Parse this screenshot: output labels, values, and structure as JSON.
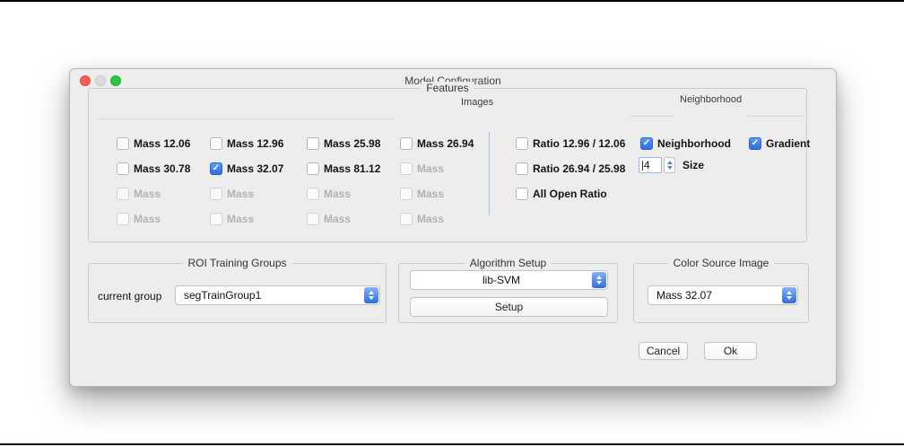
{
  "window": {
    "title": "Model Configuration"
  },
  "features": {
    "title": "Features",
    "sections": {
      "images": "Images",
      "neighborhood": "Neighborhood"
    },
    "mass_grid": [
      {
        "label": "Mass 12.06",
        "state": "unchecked"
      },
      {
        "label": "Mass 12.96",
        "state": "unchecked"
      },
      {
        "label": "Mass 25.98",
        "state": "unchecked"
      },
      {
        "label": "Mass 26.94",
        "state": "unchecked"
      },
      {
        "label": "Mass 30.78",
        "state": "unchecked"
      },
      {
        "label": "Mass 32.07",
        "state": "checked"
      },
      {
        "label": "Mass 81.12",
        "state": "unchecked"
      },
      {
        "label": "Mass",
        "state": "disabled"
      },
      {
        "label": "Mass",
        "state": "disabled"
      },
      {
        "label": "Mass",
        "state": "disabled"
      },
      {
        "label": "Mass",
        "state": "disabled"
      },
      {
        "label": "Mass",
        "state": "disabled"
      },
      {
        "label": "Mass",
        "state": "disabled"
      },
      {
        "label": "Mass",
        "state": "disabled"
      },
      {
        "label": "Mass",
        "state": "disabled"
      },
      {
        "label": "Mass",
        "state": "disabled"
      }
    ],
    "ratio_list": [
      {
        "label": "Ratio 12.96 / 12.06",
        "state": "unchecked"
      },
      {
        "label": "Ratio 26.94 / 25.98",
        "state": "unchecked"
      },
      {
        "label": "All Open Ratio",
        "state": "unchecked"
      }
    ],
    "neighborhood_checkbox": {
      "label": "Neighborhood",
      "state": "checked"
    },
    "gradient_checkbox": {
      "label": "Gradient",
      "state": "checked"
    },
    "size": {
      "value": "4",
      "label": "Size"
    }
  },
  "roi": {
    "title": "ROI Training Groups",
    "current_group_label": "current group",
    "group_select": "segTrainGroup1"
  },
  "algorithm": {
    "title": "Algorithm Setup",
    "algorithm_select": "lib-SVM",
    "setup_button": "Setup"
  },
  "color_source": {
    "title": "Color Source Image",
    "image_select": "Mass 32.07"
  },
  "buttons": {
    "cancel": "Cancel",
    "ok": "Ok"
  }
}
